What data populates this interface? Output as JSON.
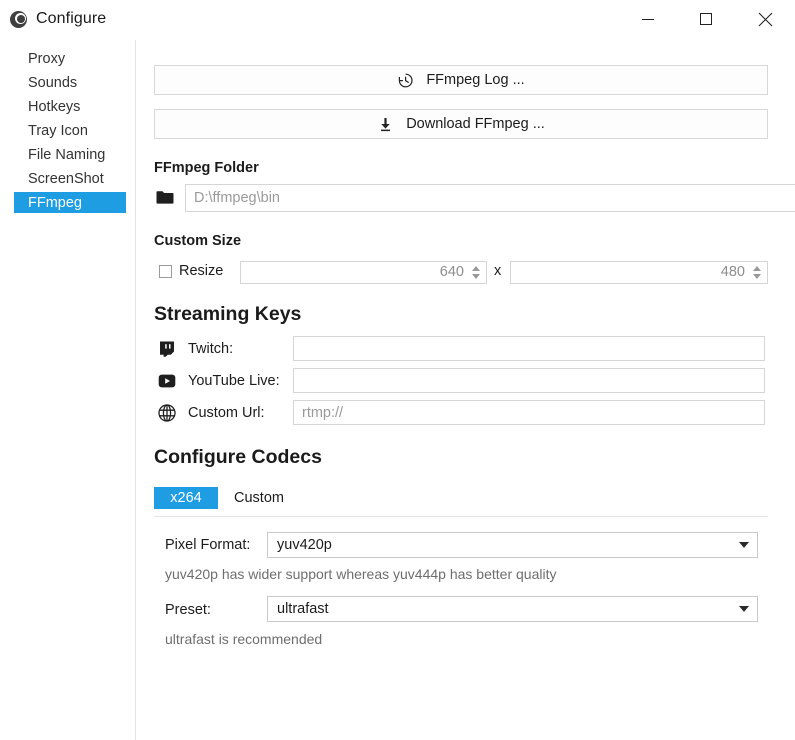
{
  "window": {
    "title": "Configure",
    "app_icon": "record-circle-icon",
    "controls": {
      "minimize": "minimize-icon",
      "maximize": "maximize-icon",
      "close": "close-icon"
    }
  },
  "sidebar": {
    "items": [
      {
        "label": "Proxy",
        "selected": false
      },
      {
        "label": "Sounds",
        "selected": false
      },
      {
        "label": "Hotkeys",
        "selected": false
      },
      {
        "label": "Tray Icon",
        "selected": false
      },
      {
        "label": "File Naming",
        "selected": false
      },
      {
        "label": "ScreenShot",
        "selected": false
      },
      {
        "label": "FFmpeg",
        "selected": true
      }
    ]
  },
  "actions": {
    "ffmpeg_log": "FFmpeg Log ...",
    "ffmpeg_log_icon": "history-icon",
    "download_ffmpeg": "Download FFmpeg ...",
    "download_ffmpeg_icon": "download-icon"
  },
  "ffmpeg_folder": {
    "heading": "FFmpeg Folder",
    "folder_icon": "folder-icon",
    "path_value": "",
    "path_placeholder": "D:\\ffmpeg\\bin",
    "clear_label": "✕",
    "browse_label": "•••"
  },
  "custom_size": {
    "heading": "Custom Size",
    "resize_label": "Resize",
    "resize_checked": false,
    "width_value": "640",
    "height_value": "480",
    "separator": "x"
  },
  "streaming_keys": {
    "heading": "Streaming Keys",
    "rows": [
      {
        "label": "Twitch:",
        "icon": "twitch-icon",
        "value": "",
        "placeholder": ""
      },
      {
        "label": "YouTube Live:",
        "icon": "youtube-icon",
        "value": "",
        "placeholder": ""
      },
      {
        "label": "Custom Url:",
        "icon": "globe-icon",
        "value": "",
        "placeholder": "rtmp://"
      }
    ]
  },
  "codecs": {
    "heading": "Configure Codecs",
    "tabs": [
      {
        "label": "x264",
        "active": true
      },
      {
        "label": "Custom",
        "active": false
      }
    ],
    "pixel_format": {
      "label": "Pixel Format:",
      "value": "yuv420p",
      "hint": "yuv420p has wider support whereas yuv444p has better quality"
    },
    "preset": {
      "label": "Preset:",
      "value": "ultrafast",
      "hint": "ultrafast is recommended"
    }
  },
  "colors": {
    "accent": "#1e9de3",
    "text": "#1c1c1c",
    "muted": "#6e6e6e",
    "border": "#d5d5d5"
  }
}
